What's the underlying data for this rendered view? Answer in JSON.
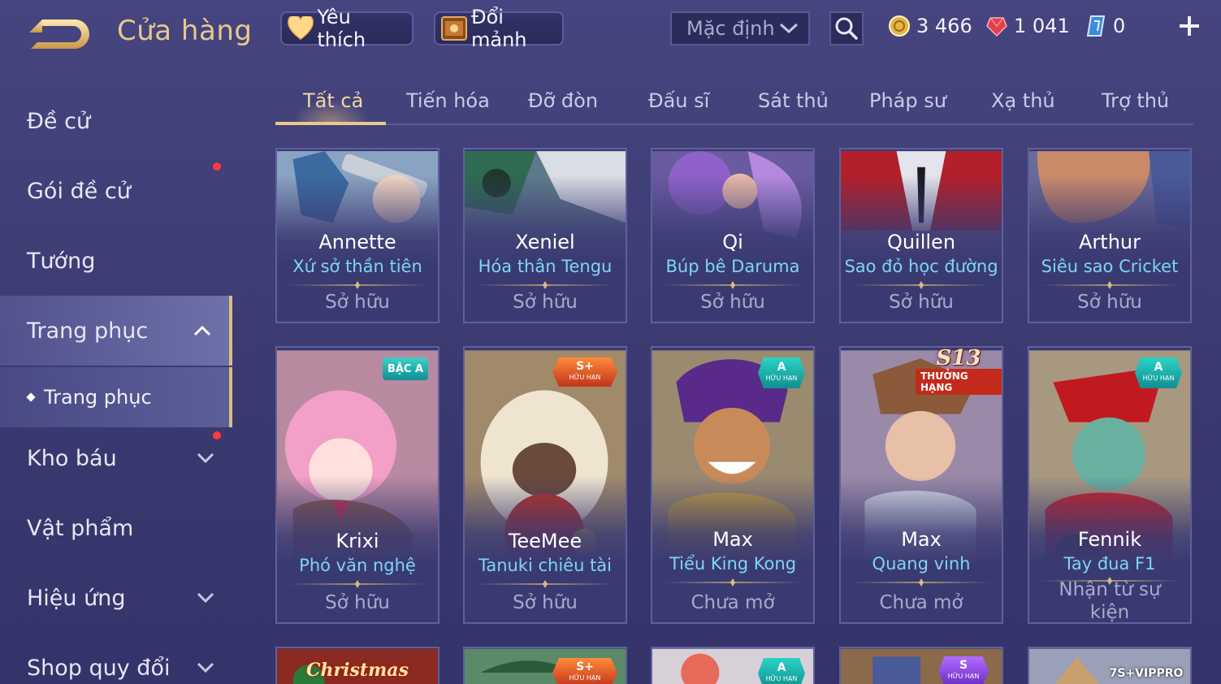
{
  "header": {
    "title": "Cửa hàng",
    "favorites_label": "Yêu thích",
    "exchange_shard_label": "Đổi mảnh",
    "sort_value": "Mặc định",
    "currencies": [
      {
        "name": "gold",
        "amount": "3 466",
        "color": "#e3b548"
      },
      {
        "name": "ruby",
        "amount": "1 041",
        "color": "#e2404f"
      },
      {
        "name": "voucher",
        "amount": "0",
        "color": "#6fb6ff"
      }
    ]
  },
  "sidebar": {
    "items": [
      {
        "label": "Đề cử",
        "has_dot": false,
        "expandable": false
      },
      {
        "label": "Gói đề cử",
        "has_dot": true,
        "expandable": false
      },
      {
        "label": "Tướng",
        "has_dot": false,
        "expandable": false
      },
      {
        "label": "Trang phục",
        "has_dot": false,
        "expandable": true,
        "expanded": true,
        "active": true
      },
      {
        "label": "Kho báu",
        "has_dot": true,
        "expandable": true
      },
      {
        "label": "Vật phẩm",
        "has_dot": false,
        "expandable": false
      },
      {
        "label": "Hiệu ứng",
        "has_dot": false,
        "expandable": true
      },
      {
        "label": "Shop quy đổi",
        "has_dot": false,
        "expandable": true
      }
    ],
    "sub_item": "Trang phục"
  },
  "tabs": [
    "Tất cả",
    "Tiến hóa",
    "Đỡ đòn",
    "Đấu sĩ",
    "Sát thủ",
    "Pháp sư",
    "Xạ thủ",
    "Trợ thủ"
  ],
  "active_tab": "Tất cả",
  "cards": [
    {
      "hero": "Annette",
      "skin": "Xứ sở thần tiên",
      "status": "Sở hữu",
      "art": "annette-art"
    },
    {
      "hero": "Xeniel",
      "skin": "Hóa thân Tengu",
      "status": "Sở hữu",
      "art": "xeniel-art"
    },
    {
      "hero": "Qi",
      "skin": "Búp bê Daruma",
      "status": "Sở hữu",
      "art": "qi-art"
    },
    {
      "hero": "Quillen",
      "skin": "Sao đỏ học đường",
      "status": "Sở hữu",
      "art": "quillen-art"
    },
    {
      "hero": "Arthur",
      "skin": "Siêu sao Cricket",
      "status": "Sở hữu",
      "art": "arthur-art"
    },
    {
      "hero": "Krixi",
      "skin": "Phó văn nghệ",
      "status": "Sở hữu",
      "badge": "BẬC A",
      "art": "krixi-art"
    },
    {
      "hero": "TeeMee",
      "skin": "Tanuki chiêu tài",
      "status": "Sở hữu",
      "badge": "S+",
      "badge_sub": "HỮU HẠN",
      "art": "teemee-art"
    },
    {
      "hero": "Max",
      "skin": "Tiểu King Kong",
      "status": "Chưa mở",
      "badge": "A",
      "badge_sub": "HỮU HẠN",
      "art": "max-kingkong-art"
    },
    {
      "hero": "Max",
      "skin": "Quang vinh",
      "status": "Chưa mở",
      "badge": "S13",
      "badge_sub": "THƯỞNG HẠNG",
      "art": "max-glory-art"
    },
    {
      "hero": "Fennik",
      "skin": "Tay đua F1",
      "status": "Nhận từ sự kiện",
      "badge": "A",
      "badge_sub": "HỮU HẠN",
      "art": "fennik-art"
    }
  ],
  "row3_badges": [
    {
      "badge": "Christmas"
    },
    {
      "badge": "S+",
      "badge_sub": "HỮU HẠN"
    },
    {
      "badge": "A",
      "badge_sub": "HỮU HẠN"
    },
    {
      "badge": "S",
      "badge_sub": "HỮU HẠN"
    },
    {
      "badge": "7S+VIPPRO"
    }
  ],
  "colors": {
    "accent_gold": "#e6c98c",
    "skin_name": "#7fd4f4",
    "notification_dot": "#ff3a3a"
  }
}
